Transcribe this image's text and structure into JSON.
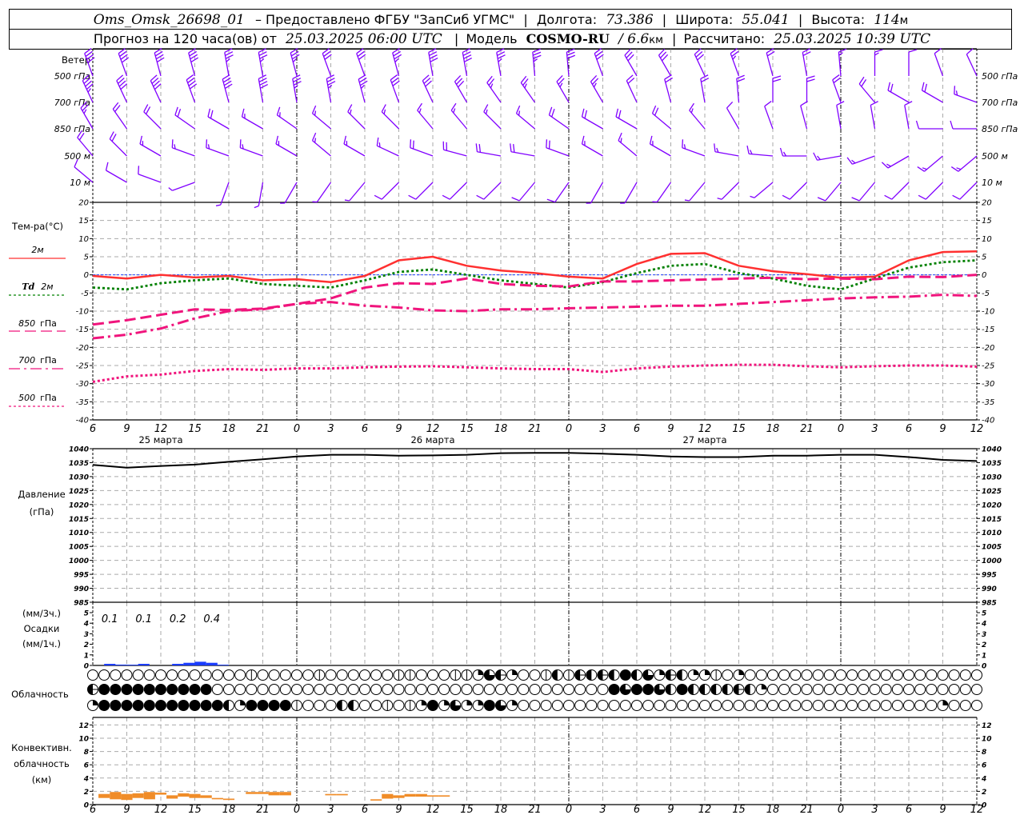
{
  "header": {
    "station": "Oms_Omsk_26698_01",
    "provided": "– Предоставлено ФГБУ \"ЗапСиб УГМС\"",
    "lon_label": "Долгота:",
    "lon": "73.386",
    "lat_label": "Широта:",
    "lat": "55.041",
    "alt_label": "Высота:",
    "alt": "114",
    "alt_unit": "м",
    "forecast_label": "Прогноз на 120 часа(ов) от",
    "forecast_time": "25.03.2025 06:00 UTC",
    "model_label": "Модель",
    "model": "COSMO-RU",
    "resolution": "/ 6.6",
    "res_unit": "км",
    "calc_label": "Рассчитано:",
    "calc_time": "25.03.2025 10:39 UTC"
  },
  "time_axis": {
    "hour_labels": [
      "6",
      "9",
      "12",
      "15",
      "18",
      "21",
      "0",
      "3",
      "6",
      "9",
      "12",
      "15",
      "18",
      "21",
      "0",
      "3",
      "6",
      "9",
      "12",
      "15",
      "18",
      "21",
      "0",
      "3",
      "6",
      "9",
      "12"
    ],
    "date_labels": [
      "25 марта",
      "26 марта",
      "27 марта"
    ]
  },
  "chart_data": [
    {
      "type": "wind-barbs",
      "title": "Ветер",
      "times": [
        "25.03 06:00",
        "25.03 09:00",
        "25.03 12:00",
        "25.03 15:00",
        "25.03 18:00",
        "25.03 21:00",
        "26.03 00:00",
        "26.03 03:00",
        "26.03 06:00",
        "26.03 09:00",
        "26.03 12:00",
        "26.03 15:00",
        "26.03 18:00",
        "26.03 21:00",
        "27.03 00:00",
        "27.03 03:00",
        "27.03 06:00",
        "27.03 09:00",
        "27.03 12:00",
        "27.03 15:00",
        "27.03 18:00",
        "27.03 21:00",
        "28.03 00:00",
        "28.03 03:00",
        "28.03 06:00",
        "28.03 09:00",
        "28.03 12:00"
      ],
      "color": "#8000ff",
      "levels": [
        {
          "label": "500 гПа",
          "dir": [
            340,
            340,
            345,
            345,
            350,
            350,
            345,
            340,
            340,
            345,
            350,
            350,
            350,
            355,
            355,
            340,
            330,
            330,
            335,
            340,
            345,
            350,
            355,
            0,
            0,
            340,
            335
          ],
          "speed": [
            20,
            20,
            20,
            20,
            18,
            18,
            17,
            15,
            15,
            18,
            20,
            20,
            18,
            17,
            15,
            15,
            15,
            15,
            15,
            12,
            10,
            10,
            8,
            8,
            6,
            5,
            5
          ]
        },
        {
          "label": "700 гПа",
          "dir": [
            335,
            335,
            335,
            340,
            345,
            350,
            350,
            350,
            345,
            340,
            335,
            330,
            325,
            325,
            330,
            330,
            335,
            345,
            350,
            355,
            0,
            0,
            340,
            320,
            300,
            300,
            290
          ],
          "speed": [
            22,
            20,
            20,
            20,
            20,
            20,
            18,
            18,
            18,
            15,
            15,
            14,
            12,
            12,
            12,
            12,
            10,
            10,
            10,
            10,
            10,
            10,
            10,
            10,
            10,
            10,
            8
          ]
        },
        {
          "label": "850 гПа",
          "dir": [
            330,
            325,
            315,
            305,
            300,
            300,
            305,
            310,
            315,
            315,
            320,
            320,
            315,
            310,
            305,
            300,
            300,
            310,
            320,
            330,
            340,
            345,
            350,
            350,
            350,
            270,
            270
          ],
          "speed": [
            12,
            10,
            10,
            10,
            10,
            8,
            8,
            8,
            8,
            8,
            8,
            8,
            8,
            8,
            10,
            10,
            10,
            10,
            8,
            6,
            6,
            5,
            5,
            5,
            5,
            5,
            5
          ]
        },
        {
          "label": "500 м",
          "dir": [
            320,
            315,
            300,
            290,
            290,
            290,
            300,
            310,
            300,
            295,
            290,
            285,
            280,
            280,
            290,
            300,
            310,
            300,
            290,
            280,
            275,
            270,
            260,
            250,
            240,
            230,
            230
          ],
          "speed": [
            10,
            10,
            8,
            8,
            8,
            8,
            8,
            8,
            8,
            8,
            10,
            10,
            10,
            10,
            10,
            8,
            8,
            8,
            8,
            8,
            8,
            8,
            8,
            8,
            8,
            8,
            8
          ]
        },
        {
          "label": "10 м",
          "dir": [
            310,
            300,
            290,
            250,
            200,
            190,
            210,
            215,
            220,
            225,
            225,
            225,
            225,
            220,
            215,
            210,
            210,
            215,
            220,
            225,
            230,
            225,
            220,
            220,
            225,
            225,
            225
          ],
          "speed": [
            6,
            6,
            5,
            3,
            3,
            3,
            3,
            3,
            3,
            4,
            4,
            4,
            4,
            4,
            4,
            3,
            3,
            3,
            3,
            3,
            3,
            4,
            4,
            4,
            4,
            4,
            4
          ]
        }
      ]
    },
    {
      "type": "line",
      "title": "Тем-ра(°C)",
      "ylim": [
        -40,
        20
      ],
      "yticks": [
        20,
        15,
        10,
        5,
        0,
        -5,
        -10,
        -15,
        -20,
        -25,
        -30,
        -35,
        -40
      ],
      "grid": true,
      "legend": "left",
      "times": [
        "25.03 06:00",
        "25.03 09:00",
        "25.03 12:00",
        "25.03 15:00",
        "25.03 18:00",
        "25.03 21:00",
        "26.03 00:00",
        "26.03 03:00",
        "26.03 06:00",
        "26.03 09:00",
        "26.03 12:00",
        "26.03 15:00",
        "26.03 18:00",
        "26.03 21:00",
        "27.03 00:00",
        "27.03 03:00",
        "27.03 06:00",
        "27.03 09:00",
        "27.03 12:00",
        "27.03 15:00",
        "27.03 18:00",
        "27.03 21:00",
        "28.03 00:00",
        "28.03 03:00",
        "28.03 06:00",
        "28.03 09:00",
        "28.03 12:00"
      ],
      "series": [
        {
          "name": "2м",
          "color": "#ff3030",
          "style": "solid",
          "values": [
            -0.3,
            -1.0,
            0,
            -0.7,
            -0.3,
            -1.5,
            -1.2,
            -2.0,
            -0.3,
            4.0,
            5.0,
            2.5,
            1.2,
            0.5,
            -0.5,
            -1.0,
            3.0,
            5.8,
            6.0,
            2.5,
            1.0,
            0.2,
            -0.8,
            -0.5,
            4.0,
            6.3,
            6.5
          ]
        },
        {
          "name": "Td 2м",
          "color": "#008000",
          "style": "dotted",
          "values": [
            -3.5,
            -4.0,
            -2.3,
            -1.5,
            -1.0,
            -2.5,
            -3.0,
            -3.5,
            -1.5,
            0.8,
            1.5,
            0,
            -1.5,
            -2.5,
            -3.5,
            -2.0,
            0.5,
            2.5,
            3.0,
            0.5,
            -1.0,
            -3.0,
            -4.0,
            -1.0,
            2.0,
            3.5,
            4.0
          ]
        },
        {
          "name": "850 гПа",
          "color": "#f0147c",
          "style": "dash",
          "values": [
            -13.7,
            -12.5,
            -11.0,
            -9.5,
            -9.7,
            -9.3,
            -8.0,
            -6.5,
            -3.5,
            -2.3,
            -2.5,
            -1.0,
            -2.5,
            -3.0,
            -3.2,
            -1.8,
            -1.8,
            -1.5,
            -1.3,
            -1.0,
            -0.8,
            -1.2,
            -1.0,
            -1.2,
            -0.5,
            -0.6,
            0
          ]
        },
        {
          "name": "700 гПа",
          "color": "#f0147c",
          "style": "dashdot",
          "values": [
            -17.5,
            -16.5,
            -14.8,
            -12.0,
            -10.0,
            -9.5,
            -8.0,
            -7.5,
            -8.5,
            -9.0,
            -9.8,
            -10.0,
            -9.5,
            -9.5,
            -9.2,
            -9.0,
            -8.8,
            -8.5,
            -8.5,
            -8.0,
            -7.5,
            -7.0,
            -6.5,
            -6.2,
            -6.0,
            -5.5,
            -5.8
          ]
        },
        {
          "name": "500 гПа",
          "color": "#f0147c",
          "style": "dotted",
          "values": [
            -29.5,
            -28.0,
            -27.5,
            -26.5,
            -26.0,
            -26.2,
            -25.8,
            -25.8,
            -25.5,
            -25.3,
            -25.2,
            -25.5,
            -25.8,
            -26.0,
            -26.0,
            -26.8,
            -25.8,
            -25.3,
            -25.0,
            -24.8,
            -24.8,
            -25.2,
            -25.5,
            -25.2,
            -25.0,
            -25.0,
            -25.3
          ]
        }
      ],
      "legend_labels": {
        "t2m": "2м",
        "td_prefix": "Td",
        "td_suffix": "2м",
        "t850_num": "850",
        "t700_num": "700",
        "t500_num": "500",
        "hpa": "гПа"
      }
    },
    {
      "type": "line",
      "title": "Давление",
      "ylabel": "(гПа)",
      "ylim": [
        985,
        1040
      ],
      "yticks": [
        1040,
        1035,
        1030,
        1025,
        1020,
        1015,
        1010,
        1005,
        1000,
        995,
        990,
        985
      ],
      "color": "#000000",
      "values": [
        1034.2,
        1033.2,
        1033.8,
        1034.3,
        1035.3,
        1036.2,
        1037.2,
        1037.8,
        1037.8,
        1037.5,
        1037.6,
        1037.8,
        1038.4,
        1038.5,
        1038.5,
        1038.2,
        1037.8,
        1037.2,
        1037.0,
        1037.0,
        1037.5,
        1037.5,
        1037.8,
        1037.8,
        1037.0,
        1036.0,
        1035.6
      ]
    },
    {
      "type": "bar",
      "title": "Осадки",
      "ylabel_top": "(мм/3ч.)",
      "ylabel_bottom": "(мм/1ч.)",
      "ylim": [
        0,
        5
      ],
      "yticks": [
        5,
        4,
        3,
        2,
        1,
        0
      ],
      "color": "#1a3cff",
      "hourly": [
        {
          "time": "25.03 07:00",
          "mm": 0.15
        },
        {
          "time": "25.03 08:00",
          "mm": 0.08
        },
        {
          "time": "25.03 09:00",
          "mm": 0.07
        },
        {
          "time": "25.03 10:00",
          "mm": 0.15
        },
        {
          "time": "25.03 13:00",
          "mm": 0.15
        },
        {
          "time": "25.03 14:00",
          "mm": 0.25
        },
        {
          "time": "25.03 15:00",
          "mm": 0.35
        },
        {
          "time": "25.03 16:00",
          "mm": 0.25
        },
        {
          "time": "25.03 17:00",
          "mm": 0.07
        }
      ],
      "totals_3h": [
        {
          "time": "25.03 06:00",
          "label": "0.1"
        },
        {
          "time": "25.03 09:00",
          "label": "0.1"
        },
        {
          "time": "25.03 12:00",
          "label": "0.2"
        },
        {
          "time": "25.03 15:00",
          "label": "0.4"
        }
      ]
    },
    {
      "type": "symbols",
      "title": "Облачность",
      "first_time": "25.03 06:00",
      "step": "1 ч",
      "rows_octas": [
        "0000000000000010000010000001100011265200141545484625422102000000000000000000000",
        "5888888888800000000000000000000000000000000000868864844445420000000000000000000",
        "2888888888884288881000440010128262286200000000000000000000000000000000000002000"
      ]
    },
    {
      "type": "bar",
      "title_lines": [
        "Конвективн.",
        "облачность",
        "(км)"
      ],
      "ylim": [
        0,
        13
      ],
      "yticks": [
        12,
        10,
        8,
        6,
        4,
        2,
        0
      ],
      "color": "#f08c28",
      "bars": [
        {
          "time": "25.03 07:00",
          "base": 1.0,
          "top": 1.6
        },
        {
          "time": "25.03 08:00",
          "base": 0.8,
          "top": 1.9
        },
        {
          "time": "25.03 09:00",
          "base": 0.7,
          "top": 1.6
        },
        {
          "time": "25.03 10:00",
          "base": 1.0,
          "top": 1.7
        },
        {
          "time": "25.03 11:00",
          "base": 0.8,
          "top": 1.9
        },
        {
          "time": "25.03 12:00",
          "base": 1.5,
          "top": 1.8
        },
        {
          "time": "25.03 13:00",
          "base": 0.9,
          "top": 1.4
        },
        {
          "time": "25.03 14:00",
          "base": 1.2,
          "top": 1.7
        },
        {
          "time": "25.03 15:00",
          "base": 1.0,
          "top": 1.6
        },
        {
          "time": "25.03 16:00",
          "base": 1.0,
          "top": 1.4
        },
        {
          "time": "25.03 17:00",
          "base": 0.8,
          "top": 1.0
        },
        {
          "time": "25.03 18:00",
          "base": 0.7,
          "top": 0.9
        },
        {
          "time": "25.03 20:00",
          "base": 1.6,
          "top": 1.9
        },
        {
          "time": "25.03 21:00",
          "base": 1.6,
          "top": 1.9
        },
        {
          "time": "25.03 22:00",
          "base": 1.4,
          "top": 1.9
        },
        {
          "time": "25.03 23:00",
          "base": 1.4,
          "top": 1.9
        },
        {
          "time": "26.03 03:00",
          "base": 1.4,
          "top": 1.6
        },
        {
          "time": "26.03 04:00",
          "base": 1.4,
          "top": 1.6
        },
        {
          "time": "26.03 07:00",
          "base": 0.6,
          "top": 0.8
        },
        {
          "time": "26.03 08:00",
          "base": 0.9,
          "top": 1.6
        },
        {
          "time": "26.03 09:00",
          "base": 1.0,
          "top": 1.4
        },
        {
          "time": "26.03 10:00",
          "base": 1.2,
          "top": 1.6
        },
        {
          "time": "26.03 11:00",
          "base": 1.2,
          "top": 1.6
        },
        {
          "time": "26.03 12:00",
          "base": 1.2,
          "top": 1.4
        },
        {
          "time": "26.03 13:00",
          "base": 1.2,
          "top": 1.4
        }
      ]
    }
  ]
}
